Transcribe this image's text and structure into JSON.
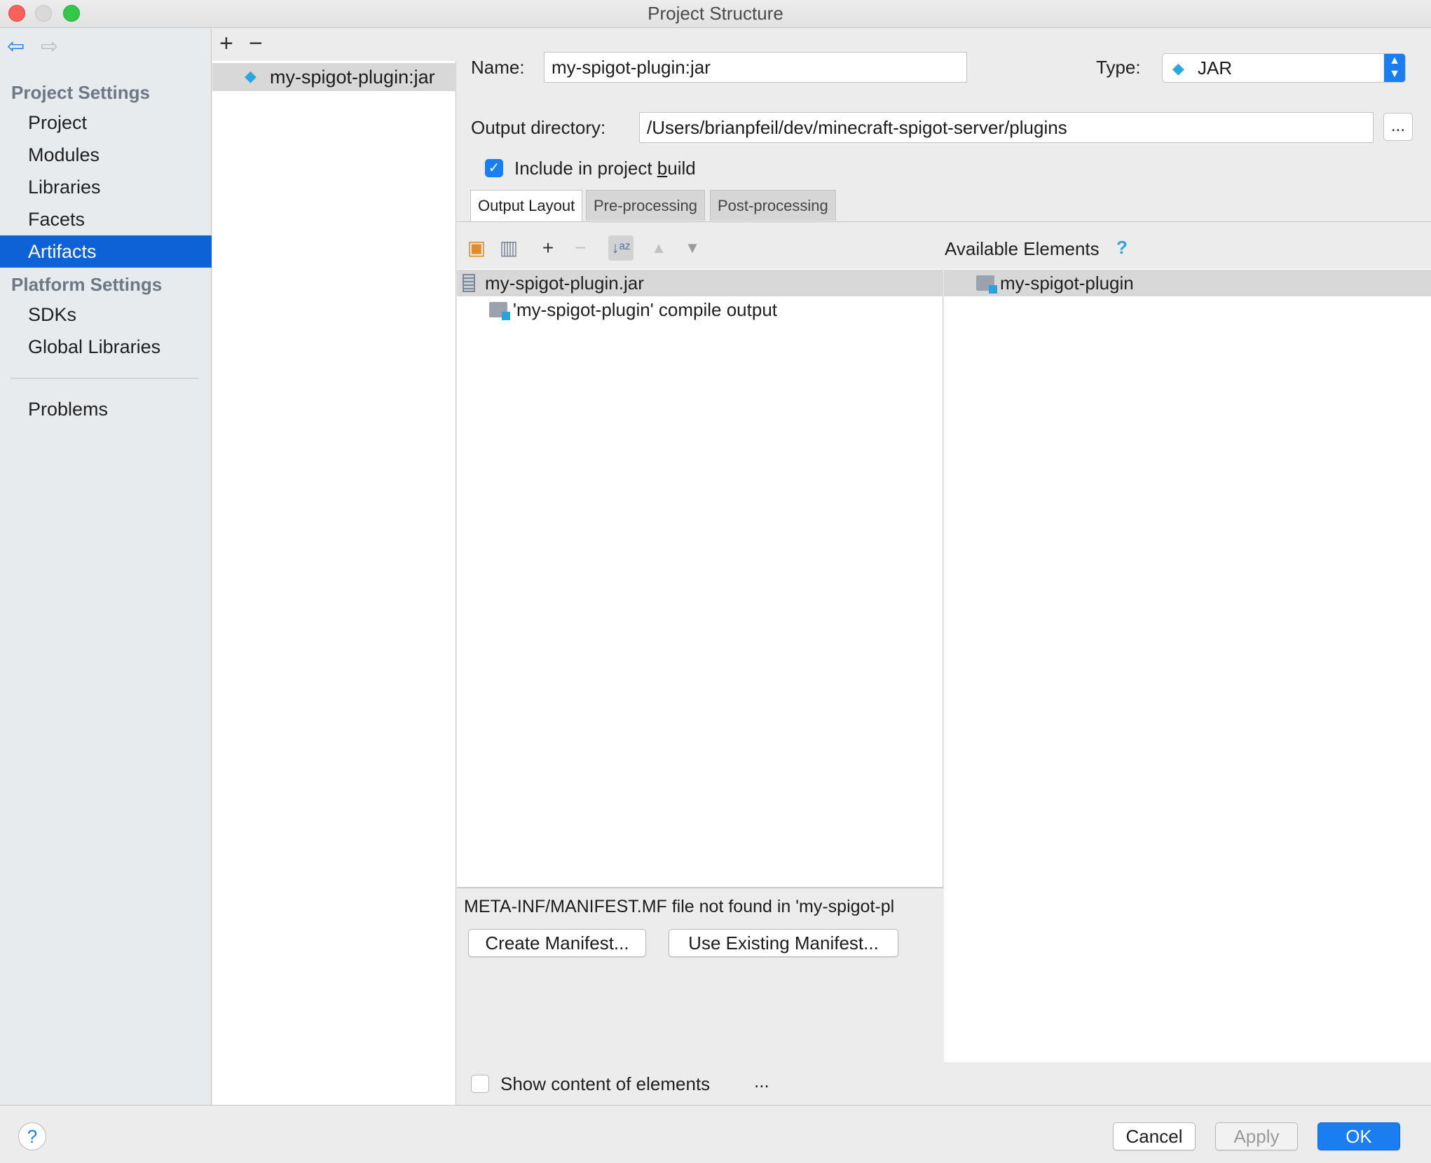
{
  "window": {
    "title": "Project Structure"
  },
  "sidebar": {
    "sections": [
      {
        "title": "Project Settings",
        "items": [
          "Project",
          "Modules",
          "Libraries",
          "Facets",
          "Artifacts"
        ]
      },
      {
        "title": "Platform Settings",
        "items": [
          "SDKs",
          "Global Libraries"
        ]
      }
    ],
    "extra_item": "Problems",
    "selected": "Artifacts"
  },
  "artifacts": {
    "items": [
      "my-spigot-plugin:jar"
    ]
  },
  "editor": {
    "name_label": "Name:",
    "name_value": "my-spigot-plugin:jar",
    "type_label": "Type:",
    "type_value": "JAR",
    "output_label": "Output directory:",
    "output_value": "/Users/brianpfeil/dev/minecraft-spigot-server/plugins",
    "ellipsis": "...",
    "include_build_label_pre": "Include in project ",
    "include_build_label_u": "b",
    "include_build_label_post": "uild",
    "include_build_checked": true,
    "tabs": [
      "Output Layout",
      "Pre-processing",
      "Post-processing"
    ],
    "active_tab": "Output Layout"
  },
  "layout_tree": {
    "root": "my-spigot-plugin.jar",
    "child": "'my-spigot-plugin' compile output"
  },
  "available": {
    "header": "Available Elements",
    "help": "?",
    "items": [
      "my-spigot-plugin"
    ]
  },
  "manifest": {
    "warning": "META-INF/MANIFEST.MF file not found in 'my-spigot-pl",
    "create_button": "Create Manifest...",
    "use_existing_button": "Use Existing Manifest..."
  },
  "show_content_label": "Show content of elements",
  "show_content_checked": false,
  "show_content_ellipsis": "...",
  "footer": {
    "help": "?",
    "cancel": "Cancel",
    "apply": "Apply",
    "ok": "OK"
  },
  "colors": {
    "accent": "#1a7ef0",
    "selection": "#0f62d6",
    "close": "#fc605b",
    "minimize": "#d9d9d9",
    "zoom": "#34c84a"
  }
}
